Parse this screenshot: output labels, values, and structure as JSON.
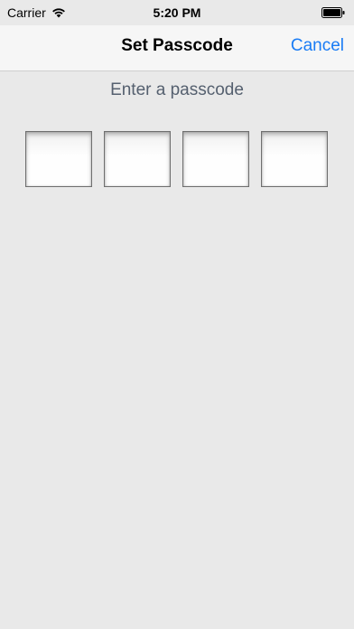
{
  "status_bar": {
    "carrier": "Carrier",
    "time": "5:20 PM",
    "wifi_icon": "wifi-icon",
    "battery_icon": "battery-icon"
  },
  "nav_bar": {
    "title": "Set Passcode",
    "cancel_label": "Cancel"
  },
  "passcode": {
    "prompt": "Enter a passcode",
    "digits": [
      "",
      "",
      "",
      ""
    ]
  },
  "colors": {
    "accent": "#1a7cf5",
    "background": "#e9e9e9",
    "prompt_text": "#55606f"
  }
}
